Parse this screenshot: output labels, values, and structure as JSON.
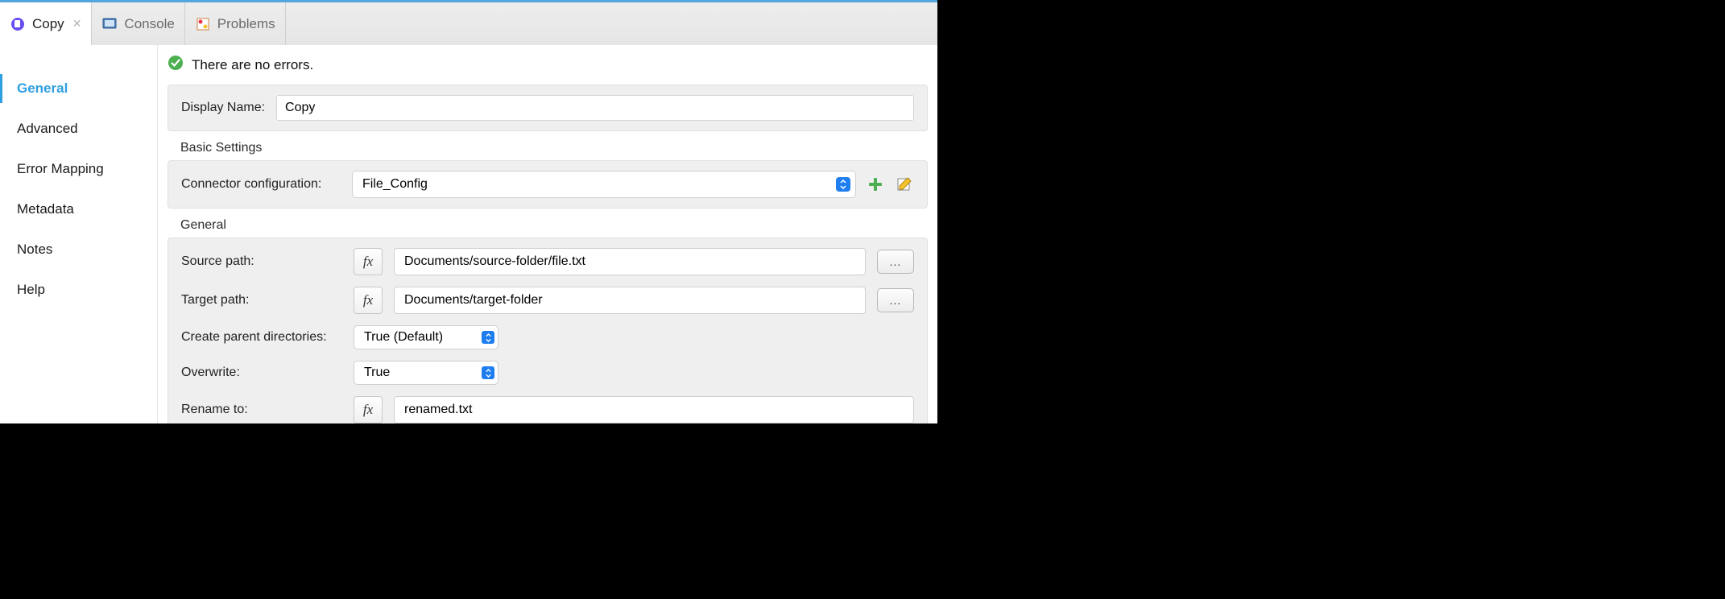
{
  "tabs": [
    {
      "label": "Copy",
      "active": true,
      "closable": true
    },
    {
      "label": "Console",
      "active": false,
      "closable": false
    },
    {
      "label": "Problems",
      "active": false,
      "closable": false
    }
  ],
  "sidebar": {
    "items": [
      "General",
      "Advanced",
      "Error Mapping",
      "Metadata",
      "Notes",
      "Help"
    ],
    "active": 0
  },
  "status": {
    "message": "There are no errors."
  },
  "displayName": {
    "label": "Display Name:",
    "value": "Copy"
  },
  "basic": {
    "title": "Basic Settings",
    "config_label": "Connector configuration:",
    "config_value": "File_Config"
  },
  "general": {
    "title": "General",
    "source_label": "Source path:",
    "source_value": "Documents/source-folder/file.txt",
    "target_label": "Target path:",
    "target_value": "Documents/target-folder",
    "createdirs_label": "Create parent directories:",
    "createdirs_value": "True (Default)",
    "overwrite_label": "Overwrite:",
    "overwrite_value": "True",
    "rename_label": "Rename to:",
    "rename_value": "renamed.txt",
    "browse_label": "..."
  }
}
